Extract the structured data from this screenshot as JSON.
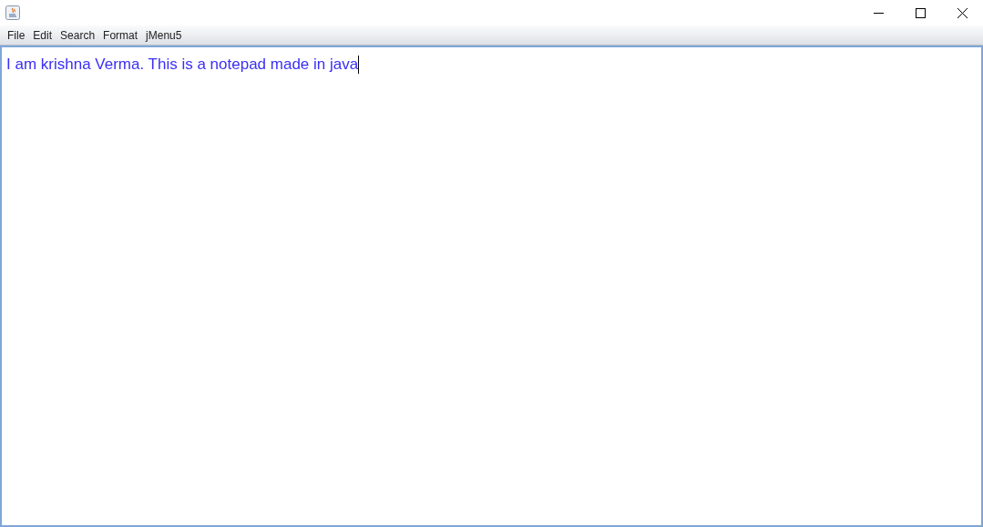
{
  "menu_bar": [
    "File",
    "Edit",
    "Search",
    "Format",
    "jMenu5"
  ],
  "editor": {
    "value": "I am krishna Verma. This is a notepad made in java"
  }
}
